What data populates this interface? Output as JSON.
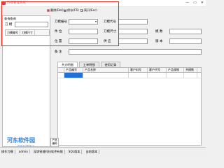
{
  "window": {
    "title": "刀模管理系统",
    "controls": {
      "minimize": "—",
      "maximize": "▭",
      "close": "✕"
    }
  },
  "toolbar": {
    "delete_label": "删除(Del)",
    "save_label": "保存(F6)",
    "exit_label": "离开(Esc)"
  },
  "sidebar": {
    "group_title": "查询查询",
    "input_label": "刀 模",
    "input_value": "",
    "grid_columns": [
      "刀模编号",
      "刀模尺寸"
    ]
  },
  "form": {
    "die_no_label": "刀模编号",
    "die_no_value": "",
    "die_code_label": "刀模代号",
    "die_code_value": "",
    "part_label": "件   位",
    "part_value": "",
    "size_label": "刀模尺寸",
    "size_value": "",
    "modulus_label": "模   数",
    "modulus_value": "",
    "location_label": "位   置",
    "location_value": "",
    "supplier_label": "供   应",
    "supplier_value": "",
    "version_label": "版   本",
    "version_value": "",
    "note_label": "备   注",
    "note_value": ""
  },
  "tabs": [
    "共刀明细",
    "工单明细",
    "使用记录"
  ],
  "grid": {
    "columns": [
      "产品编号",
      "产品名称",
      "客户料号",
      "客户代号",
      "产品规格",
      "共模数"
    ]
  },
  "side_action": {
    "label": "产品\n编码"
  },
  "status": [
    "操作刀模",
    "admin",
    "深圳锐普科技软件有限",
    "SQL版本",
    "当前版本"
  ],
  "watermark": {
    "main": "河东软件园",
    "sub": "www.pc0359.cn"
  },
  "colors": {
    "accent": "#1f6fd6",
    "highlight": "#e0281e"
  }
}
